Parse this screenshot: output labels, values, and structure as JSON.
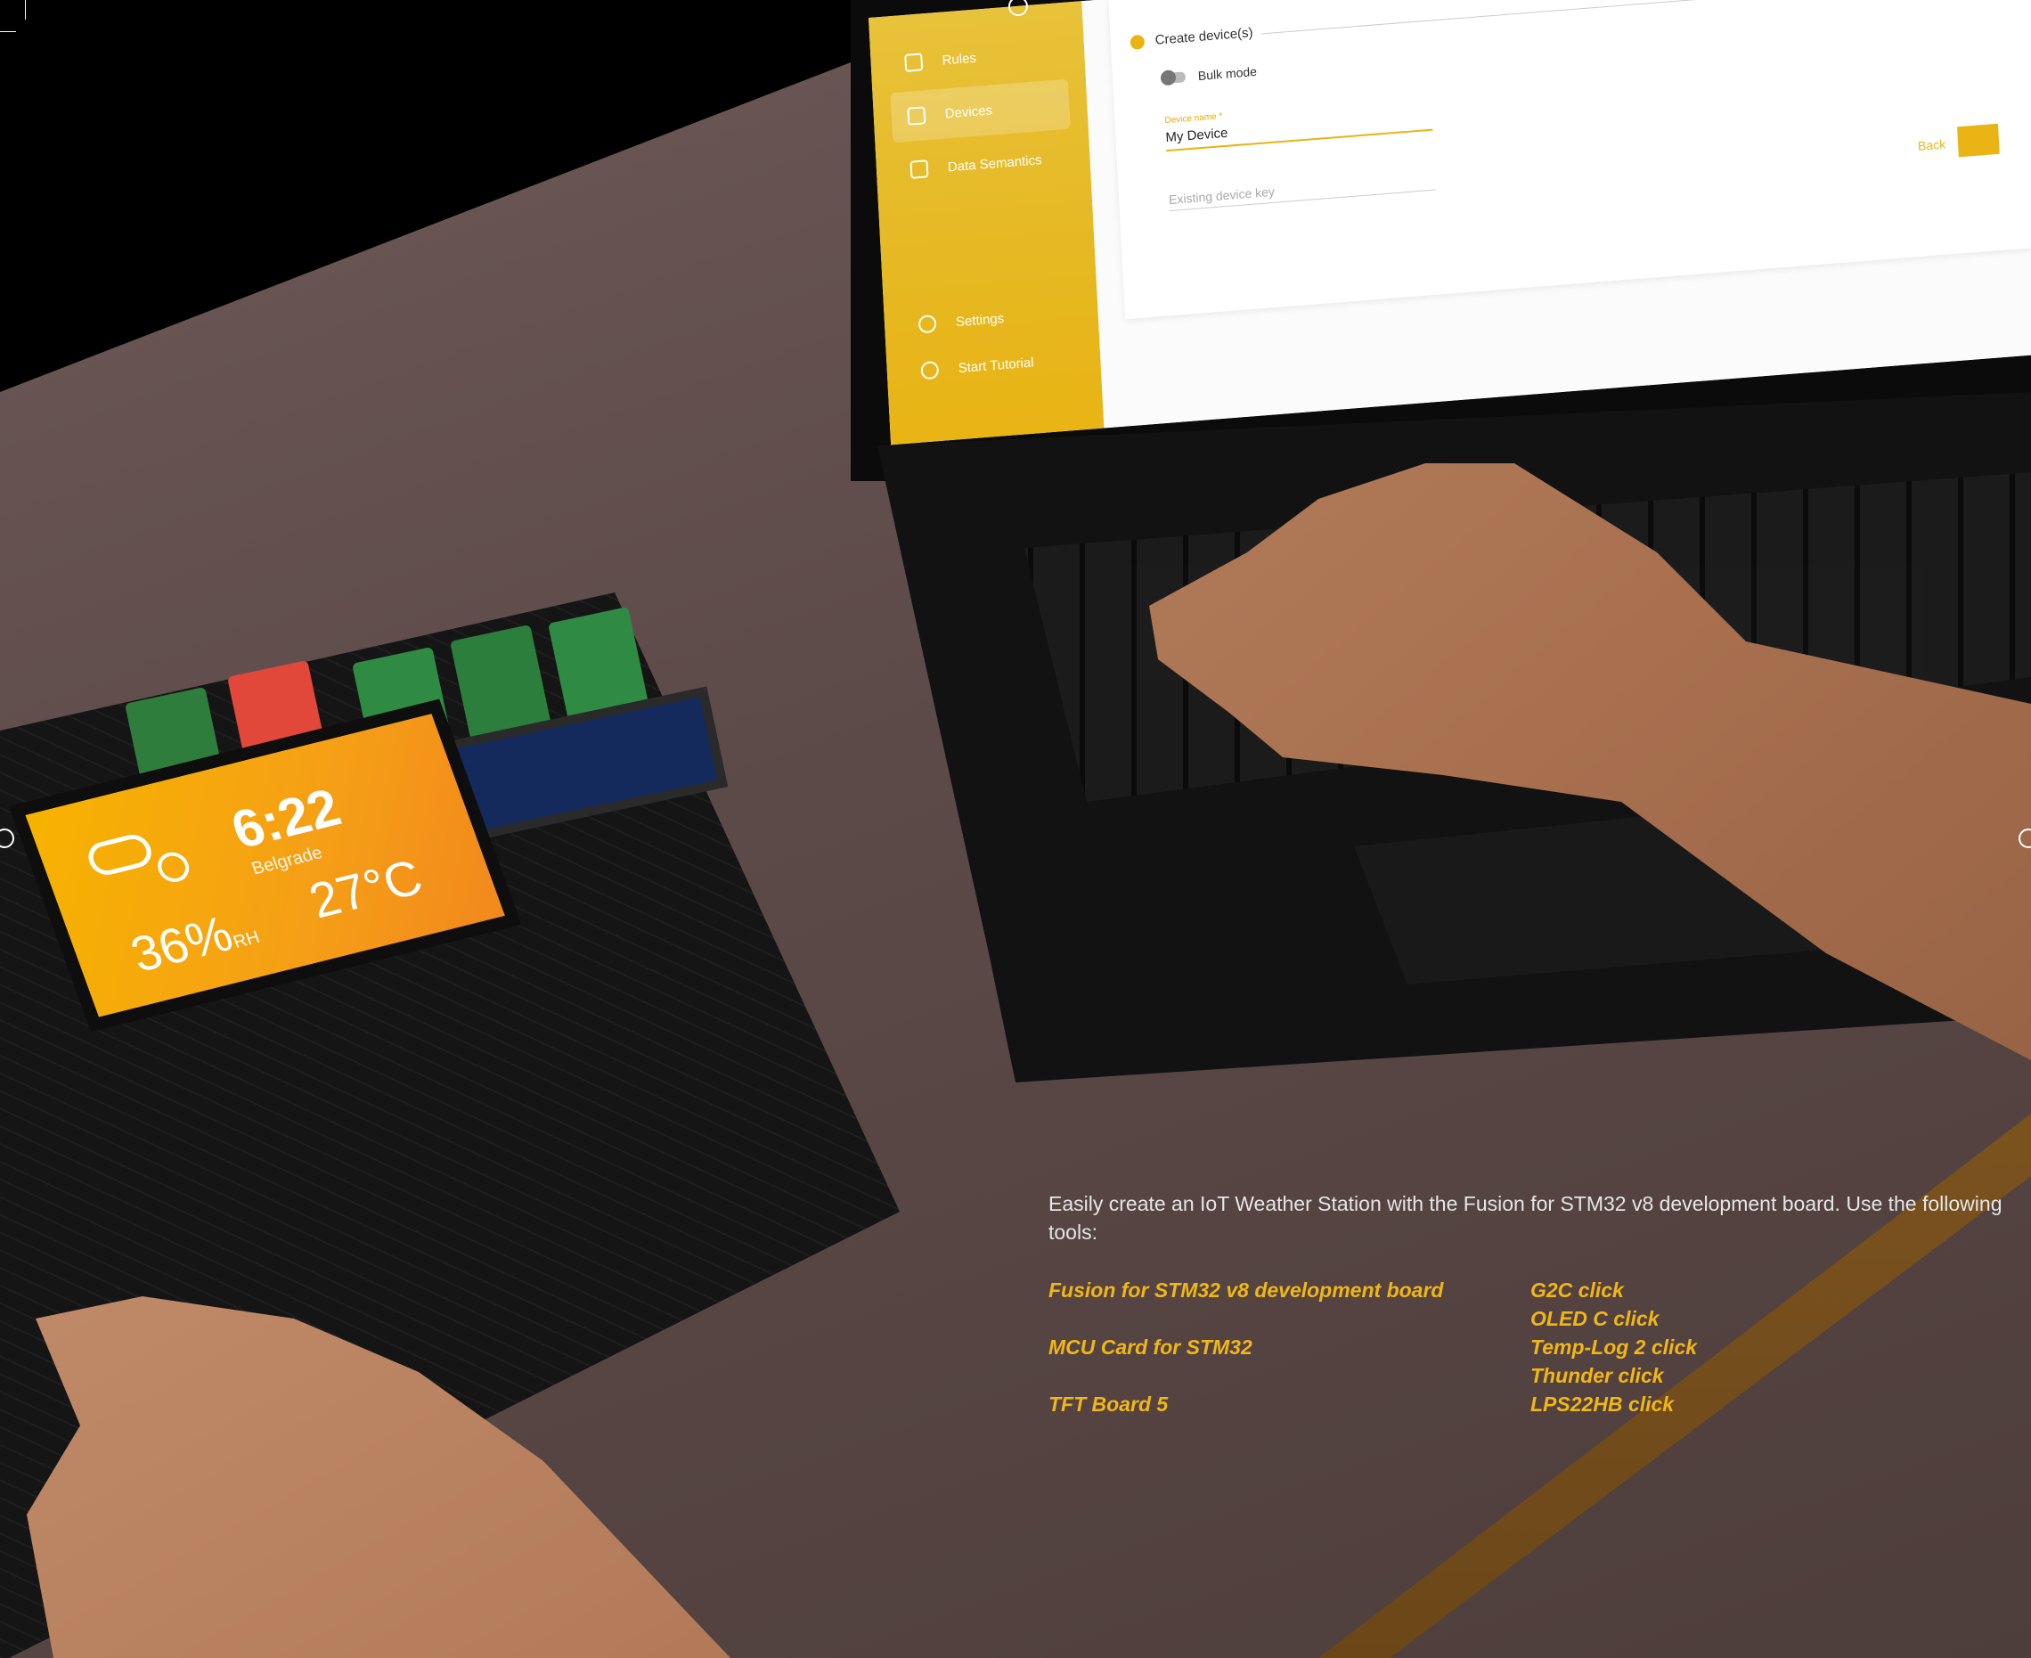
{
  "app": {
    "nav": [
      {
        "label": "Rules",
        "icon": "rules-icon"
      },
      {
        "label": "Devices",
        "icon": "devices-icon",
        "active": true
      },
      {
        "label": "Data Semantics",
        "icon": "data-semantics-icon"
      }
    ],
    "nav_bottom": [
      {
        "label": "Settings",
        "icon": "gear-icon"
      },
      {
        "label": "Start Tutorial",
        "icon": "help-icon"
      }
    ],
    "step_label": "Create device(s)",
    "bulk_mode_label": "Bulk mode",
    "device_name_label": "Device name *",
    "device_name_value": "My Device",
    "existing_key_placeholder": "Existing device key",
    "back_label": "Back",
    "accent_color": "#e9b414"
  },
  "board_display": {
    "time": "6:22",
    "city": "Belgrade",
    "humidity": "36%",
    "humidity_unit": "RH",
    "temperature": "27°C"
  },
  "caption": {
    "intro": "Easily create an IoT Weather Station with the Fusion for STM32 v8 development board. Use the following tools:",
    "tools_left": [
      "Fusion for STM32 v8 development board",
      "MCU Card for STM32",
      "TFT Board 5"
    ],
    "tools_right": [
      "G2C click",
      "OLED C click",
      "Temp-Log 2 click",
      "Thunder click",
      "LPS22HB click"
    ],
    "text_color": "#e6e6e6",
    "highlight_color": "#f0b619"
  }
}
